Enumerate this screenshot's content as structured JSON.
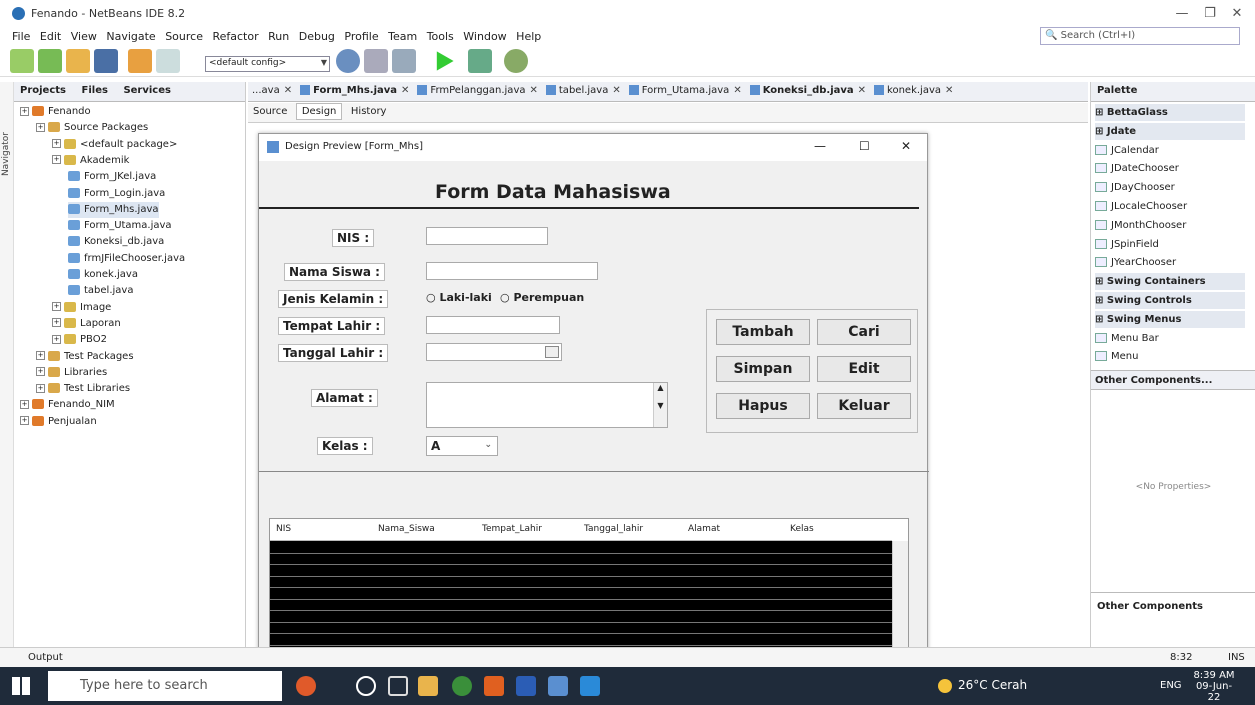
{
  "window": {
    "title": "Fenando - NetBeans IDE 8.2"
  },
  "menu": [
    "File",
    "Edit",
    "View",
    "Navigate",
    "Source",
    "Refactor",
    "Run",
    "Debug",
    "Profile",
    "Team",
    "Tools",
    "Window",
    "Help"
  ],
  "search": {
    "placeholder": "Search (Ctrl+I)"
  },
  "toolbar": {
    "config": "<default config>"
  },
  "sidebar": {
    "navigator": "Navigator"
  },
  "projects": {
    "tabs": [
      "Projects",
      "Files",
      "Services"
    ],
    "tree": [
      {
        "label": "Fenando",
        "depth": 0
      },
      {
        "label": "Source Packages",
        "depth": 1
      },
      {
        "label": "<default package>",
        "depth": 2
      },
      {
        "label": "Akademik",
        "depth": 2
      },
      {
        "label": "Form_JKel.java",
        "depth": 3
      },
      {
        "label": "Form_Login.java",
        "depth": 3
      },
      {
        "label": "Form_Mhs.java",
        "depth": 3
      },
      {
        "label": "Form_Utama.java",
        "depth": 3
      },
      {
        "label": "Koneksi_db.java",
        "depth": 3
      },
      {
        "label": "frmJFileChooser.java",
        "depth": 3
      },
      {
        "label": "konek.java",
        "depth": 3
      },
      {
        "label": "tabel.java",
        "depth": 3
      },
      {
        "label": "Image",
        "depth": 2
      },
      {
        "label": "Laporan",
        "depth": 2
      },
      {
        "label": "PBO2",
        "depth": 2
      },
      {
        "label": "Test Packages",
        "depth": 1
      },
      {
        "label": "Libraries",
        "depth": 1
      },
      {
        "label": "Test Libraries",
        "depth": 1
      },
      {
        "label": "Fenando_NIM",
        "depth": 0
      },
      {
        "label": "Penjualan",
        "depth": 0
      }
    ]
  },
  "filetabs": [
    {
      "label": "...ava",
      "bold": false
    },
    {
      "label": "Form_Mhs.java",
      "bold": true
    },
    {
      "label": "FrmPelanggan.java",
      "bold": false
    },
    {
      "label": "tabel.java",
      "bold": false
    },
    {
      "label": "Form_Utama.java",
      "bold": false
    },
    {
      "label": "Koneksi_db.java",
      "bold": true
    },
    {
      "label": "konek.java",
      "bold": false
    }
  ],
  "editor": {
    "source": "Source",
    "design": "Design",
    "history": "History"
  },
  "preview": {
    "title": "Design Preview [Form_Mhs]",
    "heading": "Form Data Mahasiswa",
    "labels": {
      "nis": "NIS :",
      "nama": "Nama Siswa :",
      "jk": "Jenis Kelamin :",
      "tempat": "Tempat Lahir :",
      "tanggal": "Tanggal Lahir :",
      "alamat": "Alamat :",
      "kelas": "Kelas :"
    },
    "radio1": "Laki-laki",
    "radio2": "Perempuan",
    "kelas_value": "A",
    "buttons": {
      "tambah": "Tambah",
      "cari": "Cari",
      "simpan": "Simpan",
      "edit": "Edit",
      "hapus": "Hapus",
      "keluar": "Keluar"
    },
    "columns": [
      "NIS",
      "Nama_Siswa",
      "Tempat_Lahir",
      "Tanggal_lahir",
      "Alamat",
      "Kelas"
    ]
  },
  "palette": {
    "title": "Palette",
    "items": [
      {
        "label": "BettaGlass",
        "cat": true
      },
      {
        "label": "Jdate",
        "cat": true
      },
      {
        "label": "JCalendar",
        "cat": false
      },
      {
        "label": "JDateChooser",
        "cat": false
      },
      {
        "label": "JDayChooser",
        "cat": false
      },
      {
        "label": "JLocaleChooser",
        "cat": false
      },
      {
        "label": "JMonthChooser",
        "cat": false
      },
      {
        "label": "JSpinField",
        "cat": false
      },
      {
        "label": "JYearChooser",
        "cat": false
      },
      {
        "label": "Swing Containers",
        "cat": true
      },
      {
        "label": "Swing Controls",
        "cat": true
      },
      {
        "label": "Swing Menus",
        "cat": true
      },
      {
        "label": "Menu Bar",
        "cat": false
      },
      {
        "label": "Menu",
        "cat": false
      }
    ],
    "other_title": "Other Components...",
    "no_props": "<No Properties>",
    "other_footer": "Other Components"
  },
  "status": {
    "output": "Output",
    "pos": "8:32",
    "mode": "INS"
  },
  "taskbar": {
    "search": "Type here to search",
    "weather": "26°C Cerah",
    "lang": "ENG",
    "time": "8:39 AM",
    "date": "09-Jun-22"
  }
}
